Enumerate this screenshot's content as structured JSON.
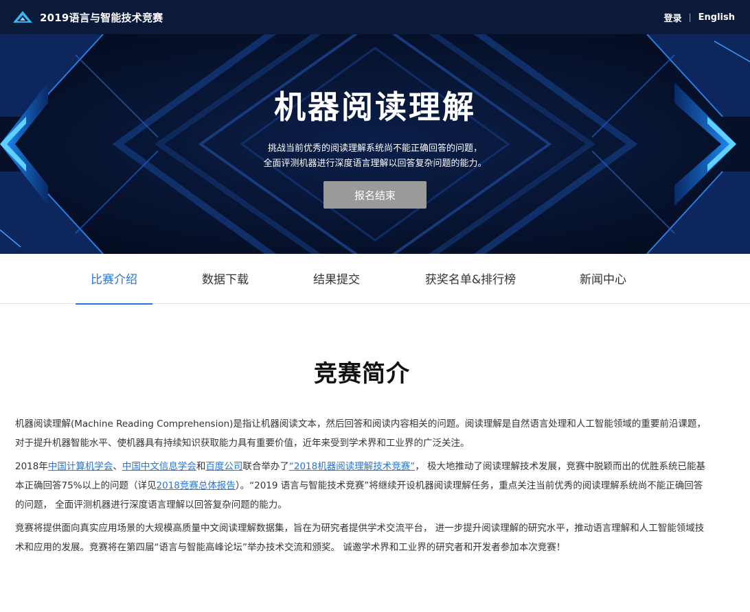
{
  "header": {
    "title": "2019语言与智能技术竞赛",
    "login": "登录",
    "separator": "|",
    "language": "English"
  },
  "hero": {
    "title": "机器阅读理解",
    "desc_line1": "挑战当前优秀的阅读理解系统尚不能正确回答的问题，",
    "desc_line2": "全面评测机器进行深度语言理解以回答复杂问题的能力。",
    "button": "报名结束"
  },
  "tabs": [
    {
      "label": "比赛介绍",
      "active": true
    },
    {
      "label": "数据下载",
      "active": false
    },
    {
      "label": "结果提交",
      "active": false
    },
    {
      "label": "获奖名单&排行榜",
      "active": false
    },
    {
      "label": "新闻中心",
      "active": false
    }
  ],
  "section": {
    "title": "竞赛简介",
    "p1": "机器阅读理解(Machine Reading Comprehension)是指让机器阅读文本，然后回答和阅读内容相关的问题。阅读理解是自然语言处理和人工智能领域的重要前沿课题，对于提升机器智能水平、使机器具有持续知识获取能力具有重要价值，近年来受到学术界和工业界的广泛关注。",
    "p2": {
      "t1": "2018年",
      "link1": "中国计算机学会",
      "t2": "、",
      "link2": "中国中文信息学会",
      "t3": "和",
      "link3": "百度公司",
      "t4": "联合举办了",
      "link4": "“2018机器阅读理解技术竞赛”",
      "t5": "， 极大地推动了阅读理解技术发展，竞赛中脱颖而出的优胜系统已能基本正确回答75%以上的问题（详见",
      "link5": "2018竞赛总体报告",
      "t6": "）。“2019 语言与智能技术竞赛”将继续开设机器阅读理解任务，重点关注当前优秀的阅读理解系统尚不能正确回答的问题， 全面评测机器进行深度语言理解以回答复杂问题的能力。"
    },
    "p3": "竞赛将提供面向真实应用场景的大规模高质量中文阅读理解数据集，旨在为研究者提供学术交流平台， 进一步提升阅读理解的研究水平，推动语言理解和人工智能领域技术和应用的发展。竞赛将在第四届“语言与智能高峰论坛”举办技术交流和颁奖。 诚邀学术界和工业界的研究者和开发者参加本次竞赛！"
  },
  "colors": {
    "header_bg": "#0c1a3a",
    "hero_bg": "#06122e",
    "accent": "#2575d6",
    "button_bg": "#9a9a9a"
  },
  "icons": {
    "logo": "triangle-logo-icon"
  }
}
